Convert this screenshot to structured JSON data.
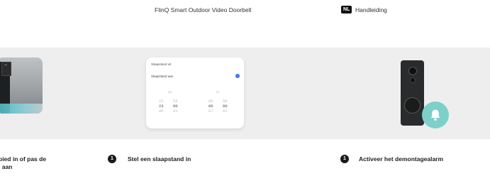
{
  "header": {
    "product_title": "FlinQ Smart Outdoor Video Doorbell",
    "language_code": "NL",
    "language_label": "Handleiding"
  },
  "card": {
    "title": "Slaapstand uit",
    "setting_label": "Slaapstand aan",
    "col_left": "Tijd",
    "col_right": "Tot",
    "picker_left_hours": [
      "22",
      "23",
      "00"
    ],
    "picker_left_minutes": [
      "59",
      "00",
      "01"
    ],
    "picker_right_hours": [
      "05",
      "06",
      "07"
    ],
    "picker_right_minutes": [
      "59",
      "00",
      "01"
    ]
  },
  "steps": [
    {
      "number": "",
      "text_line1": "bied in of pas de",
      "text_line2": "l aan"
    },
    {
      "number": "1",
      "text_line1": "Stel een slaapstand in"
    },
    {
      "number": "1",
      "text_line1": "Activeer het demontagealarm"
    }
  ],
  "colors": {
    "band": "#eeeeee",
    "bell_accent": "#7dcfca",
    "check_blue": "#3b6fd8"
  }
}
